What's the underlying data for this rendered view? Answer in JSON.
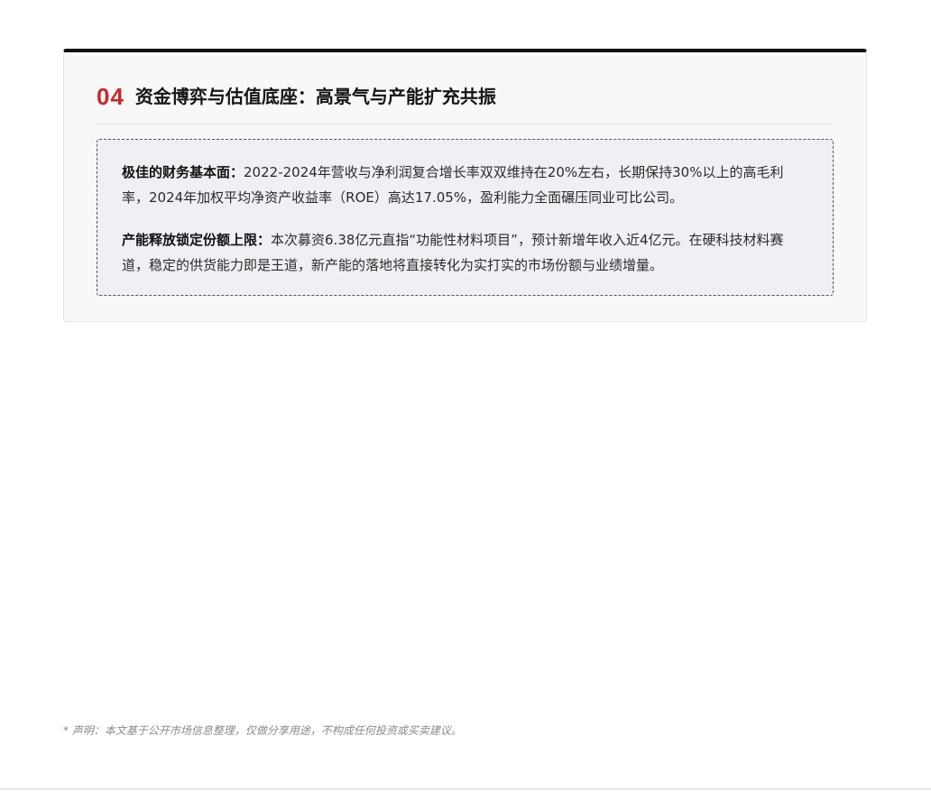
{
  "section": {
    "number": "04",
    "title": "资金博弈与估值底座：高景气与产能扩充共振"
  },
  "points": [
    {
      "lead": "极佳的财务基本面：",
      "text": "2022-2024年营收与净利润复合增长率双双维持在20%左右，长期保持30%以上的高毛利率，2024年加权平均净资产收益率（ROE）高达17.05%，盈利能力全面碾压同业可比公司。"
    },
    {
      "lead": "产能释放锁定份额上限：",
      "text": "本次募资6.38亿元直指“功能性材料项目”，预计新增年收入近4亿元。在硬科技材料赛道，稳定的供货能力即是王道，新产能的落地将直接转化为实打实的市场份额与业绩增量。"
    }
  ],
  "disclaimer": "* 声明：本文基于公开市场信息整理，仅做分享用途，不构成任何投资或买卖建议。",
  "colors": {
    "accent": "#c8282d",
    "top_border": "#111111",
    "box_background": "#eef0f4"
  }
}
